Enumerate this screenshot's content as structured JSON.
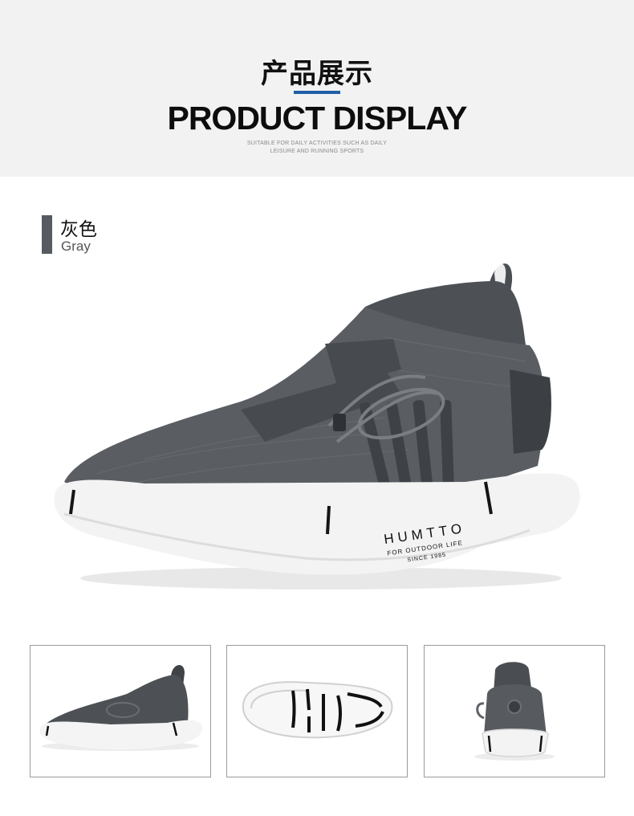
{
  "header": {
    "title_cn": "产品展示",
    "title_en": "PRODUCT DISPLAY",
    "subtitle_line1": "SUITABLE FOR DAILY ACTIVITIES SUCH AS DAILY",
    "subtitle_line2": "LEISURE AND RUNNING SPORTS",
    "accent_color": "#1f5fa6"
  },
  "color_option": {
    "name_cn": "灰色",
    "name_en": "Gray",
    "swatch_color": "#555b61"
  },
  "product": {
    "brand": "HUMTTO",
    "tagline": "FOR OUTDOOR LIFE",
    "since": "SINCE 1985"
  },
  "thumbnails": [
    {
      "view": "side",
      "icon": "shoe-side-view"
    },
    {
      "view": "sole",
      "icon": "shoe-sole-view"
    },
    {
      "view": "back",
      "icon": "shoe-back-view"
    }
  ]
}
